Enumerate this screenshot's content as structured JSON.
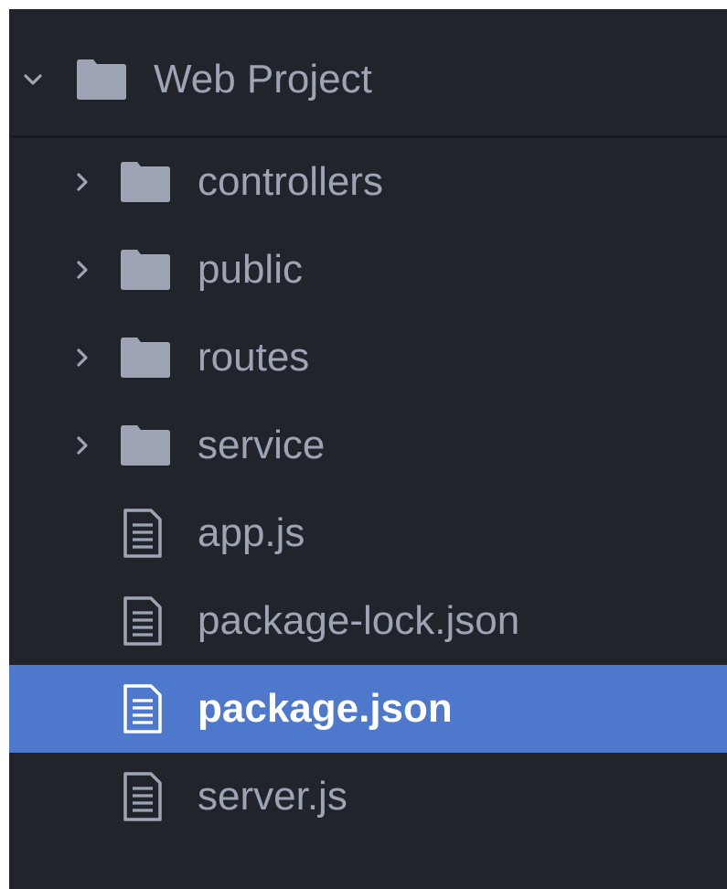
{
  "root": {
    "label": "Web Project",
    "expanded": true,
    "icon": "folder-icon"
  },
  "items": [
    {
      "label": "controllers",
      "type": "folder",
      "icon": "folder-icon",
      "expanded": false
    },
    {
      "label": "public",
      "type": "folder",
      "icon": "folder-icon",
      "expanded": false
    },
    {
      "label": "routes",
      "type": "folder",
      "icon": "folder-icon",
      "expanded": false
    },
    {
      "label": "service",
      "type": "folder",
      "icon": "folder-icon",
      "expanded": false
    },
    {
      "label": "app.js",
      "type": "file",
      "icon": "file-text-icon"
    },
    {
      "label": "package-lock.json",
      "type": "file",
      "icon": "file-text-icon"
    },
    {
      "label": "package.json",
      "type": "file",
      "icon": "file-text-icon",
      "selected": true
    },
    {
      "label": "server.js",
      "type": "file",
      "icon": "file-text-icon"
    }
  ],
  "colors": {
    "background": "#21252b",
    "text": "#9da5b4",
    "selected_background": "#4d78cc",
    "selected_text": "#ffffff",
    "icon": "#9da5b4"
  }
}
